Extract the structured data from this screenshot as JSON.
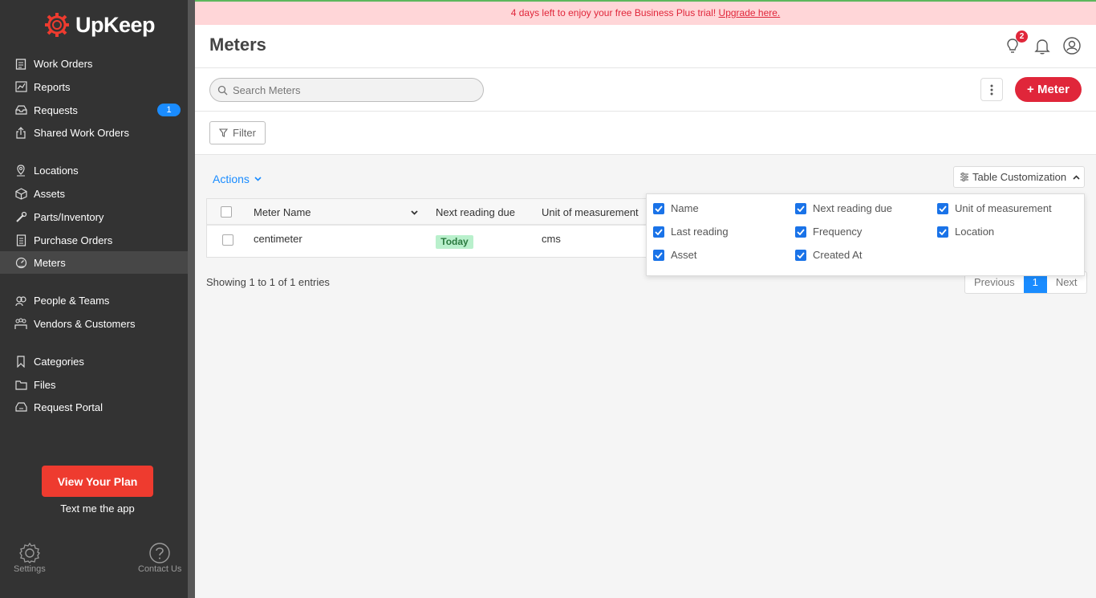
{
  "banner": {
    "text": "4 days left to enjoy your free Business Plus trial! ",
    "link": "Upgrade here."
  },
  "brand": {
    "name": "UpKeep"
  },
  "sidebar": {
    "items": [
      {
        "label": "Work Orders",
        "icon": "clipboard-icon"
      },
      {
        "label": "Reports",
        "icon": "chart-icon"
      },
      {
        "label": "Requests",
        "icon": "inbox-icon",
        "badge": "1"
      },
      {
        "label": "Shared Work Orders",
        "icon": "share-icon"
      },
      {
        "label": "Locations",
        "icon": "location-icon"
      },
      {
        "label": "Assets",
        "icon": "cube-icon"
      },
      {
        "label": "Parts/Inventory",
        "icon": "wrench-icon"
      },
      {
        "label": "Purchase Orders",
        "icon": "document-icon"
      },
      {
        "label": "Meters",
        "icon": "gauge-icon"
      },
      {
        "label": "People & Teams",
        "icon": "people-icon"
      },
      {
        "label": "Vendors & Customers",
        "icon": "vendors-icon"
      },
      {
        "label": "Categories",
        "icon": "bookmark-icon"
      },
      {
        "label": "Files",
        "icon": "folder-icon"
      },
      {
        "label": "Request Portal",
        "icon": "portal-icon"
      }
    ],
    "plan_button": "View Your Plan",
    "text_app": "Text me the app",
    "settings_label": "Settings",
    "contact_label": "Contact Us"
  },
  "header": {
    "title": "Meters",
    "notification_count": "2"
  },
  "toolbar": {
    "search_placeholder": "Search Meters",
    "add_button": "+ Meter",
    "filter_label": "Filter"
  },
  "content": {
    "actions_label": "Actions",
    "customization_label": "Table Customization",
    "columns": [
      "Meter Name",
      "Next reading due",
      "Unit of measurement"
    ],
    "rows": [
      {
        "name": "centimeter",
        "next_due": "Today",
        "unit": "cms"
      }
    ],
    "showing": "Showing 1 to 1 of 1 entries",
    "pager": {
      "previous": "Previous",
      "current": "1",
      "next": "Next"
    },
    "custom_options": [
      "Name",
      "Next reading due",
      "Unit of measurement",
      "Last reading",
      "Frequency",
      "Location",
      "Asset",
      "Created At"
    ]
  },
  "colors": {
    "accent": "#e0263a",
    "link": "#1a8cff",
    "sidebar": "#333333",
    "today_badge": "#b9f0cc"
  }
}
